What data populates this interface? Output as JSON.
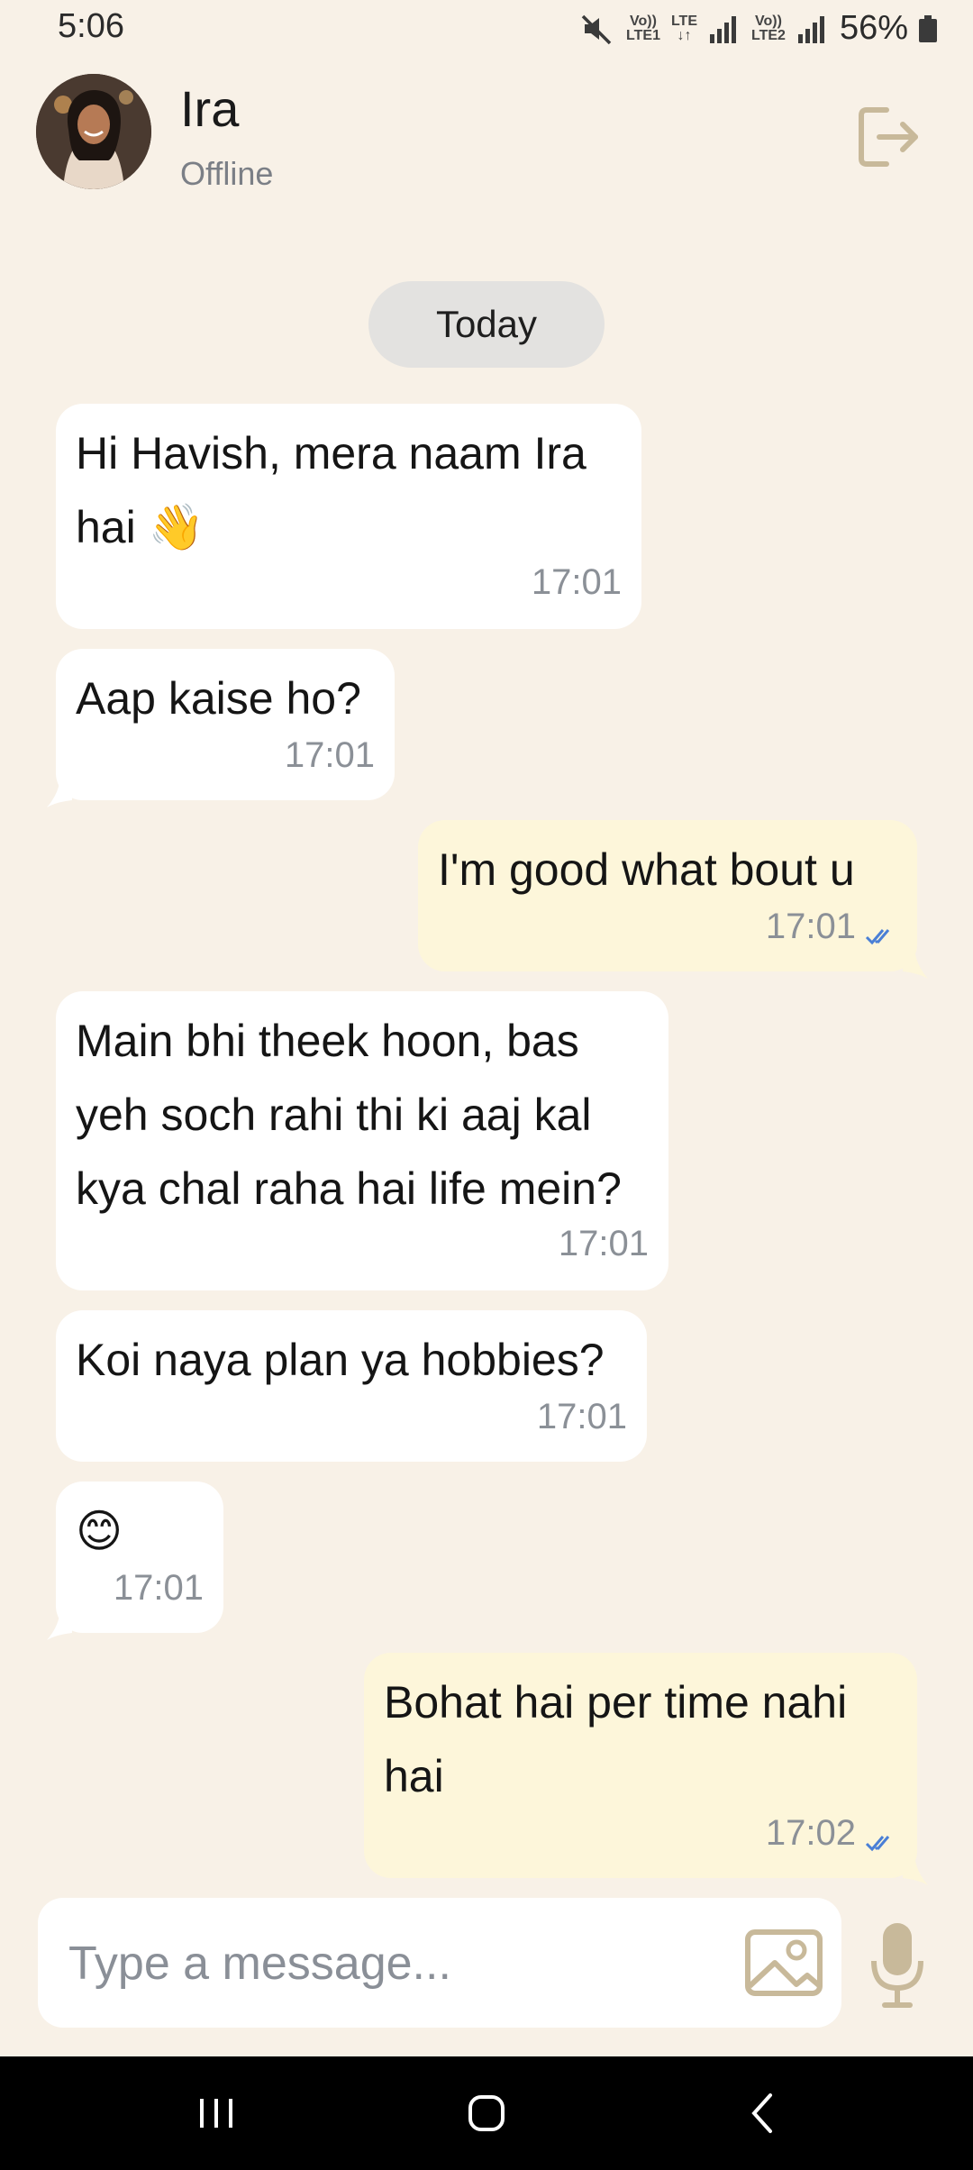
{
  "status_bar": {
    "time": "5:06",
    "net1_top": "Vo))",
    "net1_bottom": "LTE1",
    "net1_type": "LTE",
    "net2_top": "Vo))",
    "net2_bottom": "LTE2",
    "battery": "56%"
  },
  "header": {
    "name": "Ira",
    "status": "Offline",
    "logout_icon": "logout-icon"
  },
  "chat": {
    "date_label": "Today",
    "messages": [
      {
        "direction": "in",
        "text": "Hi Havish, mera naam Ira\nhai 👋",
        "time": "17:01"
      },
      {
        "direction": "in",
        "text": "Aap kaise ho?",
        "time": "17:01"
      },
      {
        "direction": "out",
        "text": "I'm good what bout u",
        "time": "17:01",
        "read": true
      },
      {
        "direction": "in",
        "text": "Main bhi theek hoon, bas\nyeh soch rahi thi ki aaj kal\nkya chal raha hai life mein?",
        "time": "17:01"
      },
      {
        "direction": "in",
        "text": "Koi naya plan ya hobbies?",
        "time": "17:01"
      },
      {
        "direction": "in",
        "text": "😊",
        "time": "17:01"
      },
      {
        "direction": "out",
        "text": "Bohat hai per time nahi\nhai",
        "time": "17:02",
        "read": true
      }
    ]
  },
  "composer": {
    "placeholder": "Type a message...",
    "value": "",
    "gallery_icon": "image-icon",
    "mic_icon": "mic-icon"
  },
  "colors": {
    "background": "#f8f1e7",
    "incoming_bubble": "#ffffff",
    "outgoing_bubble": "#fdf6da",
    "accent_icon": "#c8b99a",
    "read_ticks": "#4a7fd6"
  },
  "nav_bar": {
    "recents_icon": "recents-icon",
    "home_icon": "home-icon",
    "back_icon": "back-icon"
  }
}
